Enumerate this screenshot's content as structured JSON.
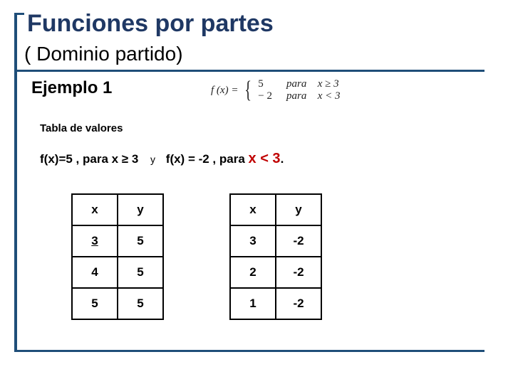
{
  "title": "Funciones por partes",
  "subtitle": "( Dominio partido)",
  "example_label": "Ejemplo 1",
  "formula": {
    "lhs": "f (x) =",
    "row1_val": "5",
    "row1_para": "para",
    "row1_cond": "x ≥ 3",
    "row2_val": "− 2",
    "row2_para": "para",
    "row2_cond": "x < 3"
  },
  "table_label": "Tabla de valores",
  "condition_line": {
    "part1": "f(x)=5 ,  para  x ≥ 3",
    "sep": "y",
    "part2a": "f(x) = -2 ,  para ",
    "part2b": "x < 3",
    "part2c": "."
  },
  "table1": {
    "hx": "x",
    "hy": "y",
    "rows": [
      {
        "x": "3",
        "y": "5",
        "xunder": true
      },
      {
        "x": "4",
        "y": "5"
      },
      {
        "x": "5",
        "y": "5"
      }
    ]
  },
  "table2": {
    "hx": "x",
    "hy": "y",
    "rows": [
      {
        "x": "3",
        "y": "-2"
      },
      {
        "x": "2",
        "y": "-2"
      },
      {
        "x": "1",
        "y": "-2"
      }
    ]
  }
}
